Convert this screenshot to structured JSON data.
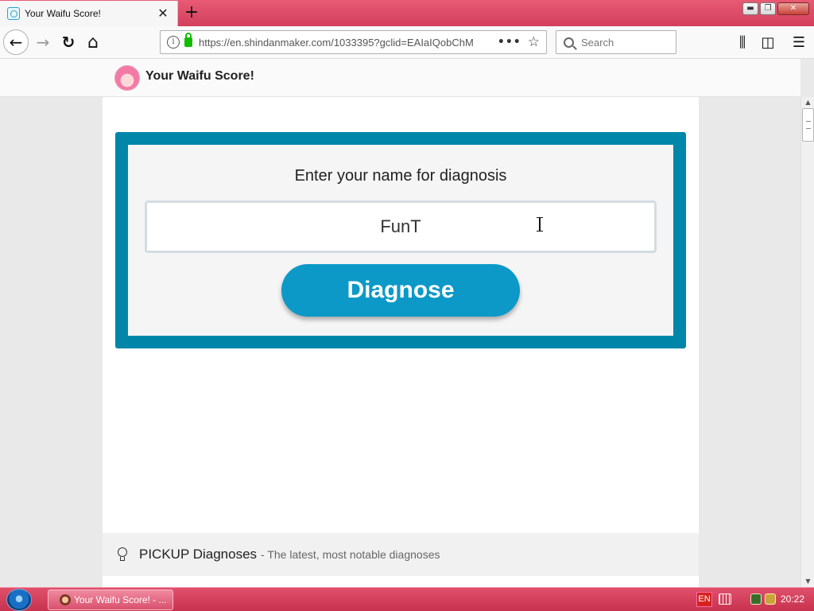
{
  "browser": {
    "tab": {
      "title": "Your Waifu Score!",
      "close_glyph": "✕",
      "icon": "shindanmaker-favicon"
    },
    "new_tab_glyph": "+",
    "window_buttons": {
      "minimize": "▬",
      "restore": "❐",
      "close": "✕"
    },
    "nav": {
      "back_glyph": "←",
      "forward_glyph": "→",
      "reload_glyph": "↻",
      "home_glyph": "⌂",
      "url": "https://en.shindanmaker.com/1033395?gclid=EAIaIQobChM",
      "url_more_glyph": "•••",
      "bookmark_glyph": "☆",
      "search_placeholder": "Search",
      "library_glyph": "⫼",
      "sidebar_glyph": "◫",
      "menu_glyph": "☰"
    }
  },
  "page": {
    "site_title": "Your Waifu Score!",
    "form": {
      "prompt": "Enter your name for diagnosis",
      "name_value": "FunT",
      "button_label": "Diagnose"
    },
    "pickup": {
      "title": "PICKUP Diagnoses",
      "subtitle": "- The latest, most notable diagnoses"
    }
  },
  "scrollbar": {
    "up_glyph": "▲",
    "down_glyph": "▼"
  },
  "taskbar": {
    "item_label": "Your Waifu Score! - ...",
    "language": "EN",
    "time": "20:22"
  },
  "colors": {
    "titlebar": "#d23f5d",
    "form_frame": "#0086a9",
    "diagnose_button": "#0c99c8",
    "taskbar": "#c8334f"
  }
}
